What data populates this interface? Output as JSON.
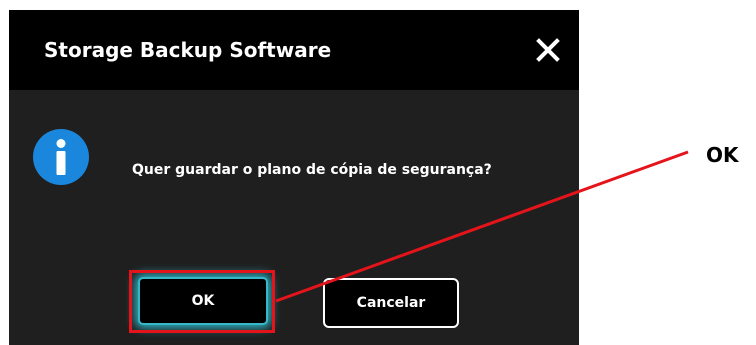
{
  "dialog": {
    "title": "Storage Backup Software",
    "close_icon": "close-icon",
    "info_icon": "info-icon",
    "message": "Quer guardar o plano de cópia de segurança?",
    "ok_label": "OK",
    "cancel_label": "Cancelar"
  },
  "annotation": {
    "label": "OK",
    "highlight_color": "#e5141b"
  },
  "colors": {
    "titlebar": "#000000",
    "body": "#1f1f1f",
    "info_icon": "#1a86dc",
    "focus_glow": "#35b8c7"
  }
}
